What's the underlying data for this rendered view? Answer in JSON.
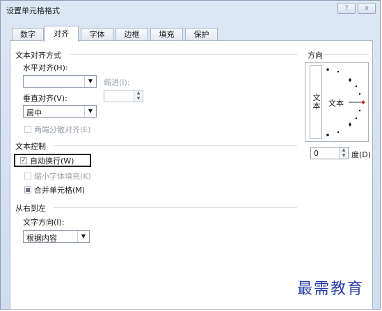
{
  "window": {
    "title": "设置单元格格式",
    "help_glyph": "?",
    "close_glyph": "x"
  },
  "tabs": [
    {
      "label": "数字",
      "active": false
    },
    {
      "label": "对齐",
      "active": true
    },
    {
      "label": "字体",
      "active": false
    },
    {
      "label": "边框",
      "active": false
    },
    {
      "label": "填充",
      "active": false
    },
    {
      "label": "保护",
      "active": false
    }
  ],
  "text_alignment": {
    "group_title": "文本对齐方式",
    "horizontal_label": "水平对齐(H):",
    "horizontal_value": "",
    "indent_label": "缩进(I):",
    "indent_value": "",
    "vertical_label": "垂直对齐(V):",
    "vertical_value": "居中",
    "distributed_label": "两端分散对齐(E)"
  },
  "text_control": {
    "group_title": "文本控制",
    "wrap_text_label": "自动换行(W)",
    "wrap_text_checked": true,
    "shrink_to_fit_label": "缩小字体填充(K)",
    "shrink_to_fit_checked": false,
    "merge_cells_label": "合并单元格(M)",
    "merge_cells_state": "indeterminate"
  },
  "rtl": {
    "group_title": "从右到左",
    "direction_label": "文字方向(I):",
    "direction_value": "根据内容"
  },
  "orientation": {
    "group_title": "方向",
    "vertical_text": "文本",
    "dial_text": "文本",
    "degrees_value": "0",
    "degrees_label": "度(D)"
  },
  "watermark": "最需教育",
  "colors": {
    "title_bar": "#dce7f4",
    "dial_marker": "#c0392b",
    "watermark": "#2a3ea6"
  }
}
